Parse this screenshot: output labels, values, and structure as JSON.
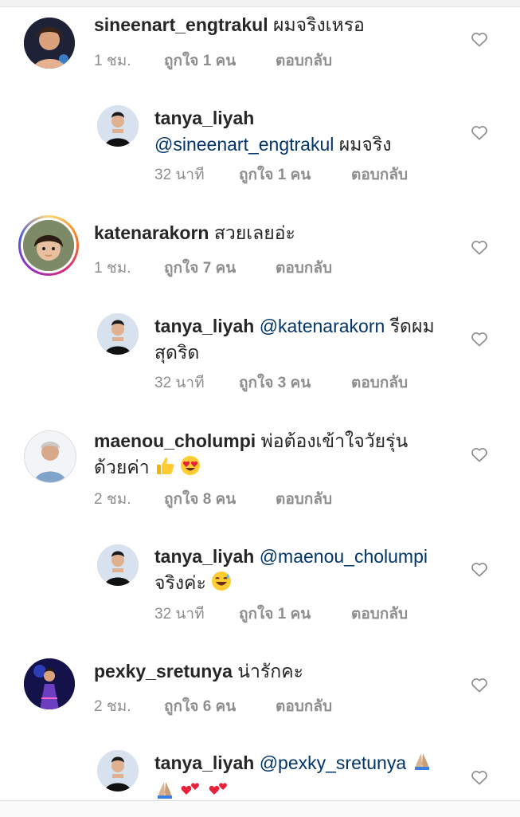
{
  "comments": [
    {
      "user": "sineenart_engtrakul",
      "text": "ผมจริงเหรอ",
      "time": "1 ชม.",
      "likes": "ถูกใจ 1 คน",
      "reply": "ตอบกลับ"
    },
    {
      "user": "tanya_liyah",
      "mention": "@sineenart_engtrakul",
      "text": "ผมจริง",
      "time": "32 นาที",
      "likes": "ถูกใจ 1 คน",
      "reply": "ตอบกลับ"
    },
    {
      "user": "katenarakorn",
      "text": "สวยเลยอ่ะ",
      "time": "1 ชม.",
      "likes": "ถูกใจ 7 คน",
      "reply": "ตอบกลับ"
    },
    {
      "user": "tanya_liyah",
      "mention": "@katenarakorn",
      "text": "รีดผม",
      "text2": "สุดริด",
      "time": "32 นาที",
      "likes": "ถูกใจ 3 คน",
      "reply": "ตอบกลับ"
    },
    {
      "user": "maenou_cholumpi",
      "text": "พ่อต้องเข้าใจวัยรุ่น",
      "text2": "ด้วยค่า",
      "time": "2 ชม.",
      "likes": "ถูกใจ 8 คน",
      "reply": "ตอบกลับ"
    },
    {
      "user": "tanya_liyah",
      "mention": "@maenou_cholumpi",
      "text2": "จริงค่ะ",
      "time": "32 นาที",
      "likes": "ถูกใจ 1 คน",
      "reply": "ตอบกลับ"
    },
    {
      "user": "pexky_sretunya",
      "text": "น่ารักคะ",
      "time": "2 ชม.",
      "likes": "ถูกใจ 6 คน",
      "reply": "ตอบกลับ"
    },
    {
      "user": "tanya_liyah",
      "mention": "@pexky_sretunya",
      "time": "",
      "likes": "",
      "reply": ""
    }
  ],
  "icons": {
    "like": "heart-outline-icon",
    "story_ring": "story-ring"
  },
  "colors": {
    "text": "#262626",
    "mention": "#003569",
    "meta": "#8e8e8e",
    "heart": "#8e8e8e"
  }
}
